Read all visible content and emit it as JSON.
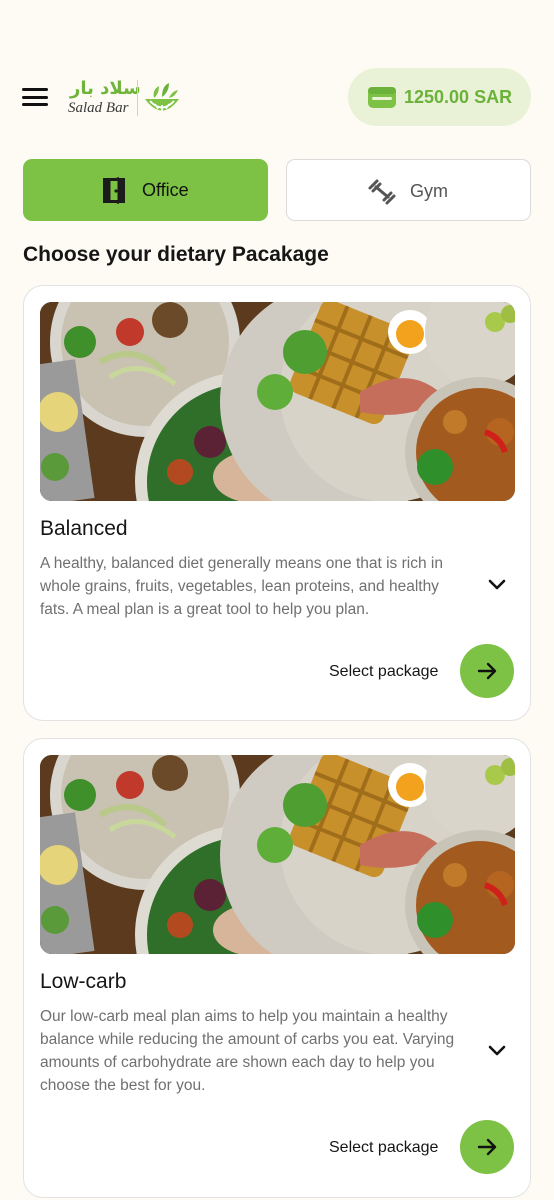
{
  "header": {
    "menu_icon": "hamburger-menu-icon",
    "logo": {
      "arabic": "سلاد بار",
      "english": "Salad Bar"
    },
    "wallet": {
      "icon": "wallet-icon",
      "amount": "1250.00 SAR"
    }
  },
  "tabs": [
    {
      "label": "Office",
      "icon": "door-icon",
      "selected": true
    },
    {
      "label": "Gym",
      "icon": "dumbbell-icon",
      "selected": false
    }
  ],
  "section_title": "Choose your dietary Pacakage",
  "packages": [
    {
      "title": "Balanced",
      "description": "A healthy, balanced diet generally means one that is rich in whole grains, fruits, vegetables, lean proteins, and healthy fats. A meal plan is a great tool to help you plan.",
      "select_label": "Select package"
    },
    {
      "title": "Low-carb",
      "description": "Our low-carb meal plan aims to help you maintain a healthy balance while reducing the amount of carbs you eat. Varying amounts of carbohydrate are shown each day to help you choose the best for you.",
      "select_label": "Select package"
    }
  ],
  "colors": {
    "accent": "#7DC244",
    "accent_text": "#6BB23A",
    "wallet_bg": "#E9F1D6",
    "page_bg": "#FDFBF3"
  }
}
